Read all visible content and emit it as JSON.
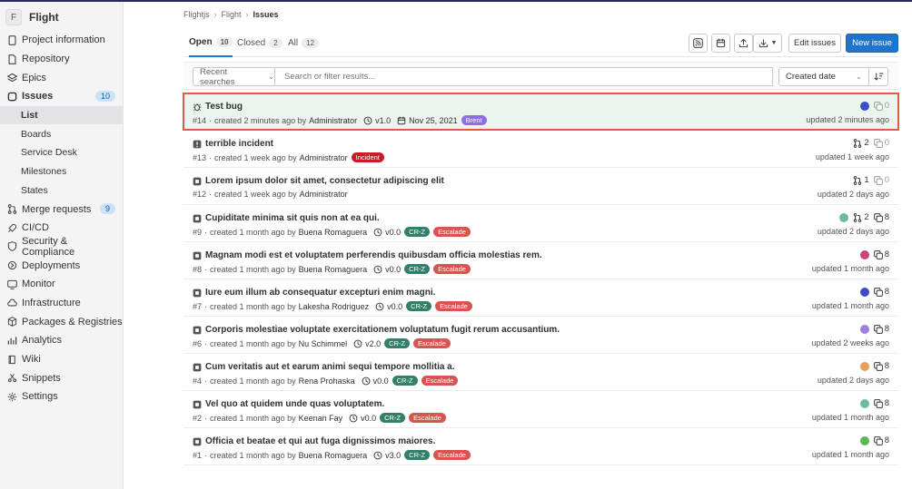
{
  "project": {
    "avatar_letter": "F",
    "name": "Flight"
  },
  "sidebar": {
    "items": [
      {
        "label": "Project information",
        "icon": "info-icon"
      },
      {
        "label": "Repository",
        "icon": "doc-icon"
      },
      {
        "label": "Epics",
        "icon": "epic-icon"
      },
      {
        "label": "Issues",
        "icon": "issues-icon",
        "count": "10"
      },
      {
        "label": "Merge requests",
        "icon": "merge-request-icon",
        "count": "9"
      },
      {
        "label": "CI/CD",
        "icon": "rocket-icon"
      },
      {
        "label": "Security & Compliance",
        "icon": "shield-icon"
      },
      {
        "label": "Deployments",
        "icon": "deployments-icon"
      },
      {
        "label": "Monitor",
        "icon": "monitor-icon"
      },
      {
        "label": "Infrastructure",
        "icon": "cloud-icon"
      },
      {
        "label": "Packages & Registries",
        "icon": "package-icon"
      },
      {
        "label": "Analytics",
        "icon": "chart-icon"
      },
      {
        "label": "Wiki",
        "icon": "book-icon"
      },
      {
        "label": "Snippets",
        "icon": "snippet-icon"
      },
      {
        "label": "Settings",
        "icon": "gear-icon"
      }
    ],
    "issues_sub": [
      "List",
      "Boards",
      "Service Desk",
      "Milestones",
      "States"
    ]
  },
  "breadcrumb": {
    "group": "Flightjs",
    "project": "Flight",
    "current": "Issues"
  },
  "tabs": [
    {
      "label": "Open",
      "count": "10"
    },
    {
      "label": "Closed",
      "count": "2"
    },
    {
      "label": "All",
      "count": "12"
    }
  ],
  "actions": {
    "edit_label": "Edit issues",
    "new_label": "New issue"
  },
  "filter": {
    "recent_label": "Recent searches",
    "search_placeholder": "Search or filter results...",
    "sort_label": "Created date"
  },
  "colors": {
    "accent": "#1f75cb",
    "crz": "#347f6a",
    "escalade": "#d9534f",
    "incident": "#c91c28",
    "brent": "#8f6fe0",
    "highlight": "#e05b3f"
  },
  "issues": [
    {
      "title": "Test bug",
      "type": "bug",
      "ref": "#14",
      "created": "created 2 minutes ago by",
      "author": "Administrator",
      "milestone": "v1.0",
      "due": "Nov 25, 2021",
      "labels": [
        {
          "text": "Brent",
          "color": "#8f6fe0"
        }
      ],
      "mr": "",
      "comments": "0",
      "updated": "updated 2 minutes ago",
      "avatar_color": "#3b4fc4"
    },
    {
      "title": "terrible incident",
      "type": "incident",
      "ref": "#13",
      "created": "created 1 week ago by",
      "author": "Administrator",
      "milestone": "",
      "due": "",
      "labels": [
        {
          "text": "Incident",
          "color": "#c91c28"
        }
      ],
      "mr": "2",
      "comments": "0",
      "updated": "updated 1 week ago",
      "avatar_color": ""
    },
    {
      "title": "Lorem ipsum dolor sit amet, consectetur adipiscing elit",
      "type": "issue",
      "ref": "#12",
      "created": "created 1 week ago by",
      "author": "Administrator",
      "milestone": "",
      "due": "",
      "labels": [],
      "mr": "1",
      "comments": "0",
      "updated": "updated 2 days ago",
      "avatar_color": ""
    },
    {
      "title": "Cupiditate minima sit quis non at ea qui.",
      "type": "issue",
      "ref": "#9",
      "created": "created 1 month ago by",
      "author": "Buena Romaguera",
      "milestone": "v0.0",
      "due": "",
      "labels": [
        {
          "text": "CR-Z",
          "color": "#347f6a"
        },
        {
          "text": "Escalade",
          "color": "#d9534f"
        }
      ],
      "mr": "2",
      "comments": "8",
      "updated": "updated 2 days ago",
      "avatar_color": "#6fb8a3"
    },
    {
      "title": "Magnam modi est et voluptatem perferendis quibusdam officia molestias rem.",
      "type": "issue",
      "ref": "#8",
      "created": "created 1 month ago by",
      "author": "Buena Romaguera",
      "milestone": "v0.0",
      "due": "",
      "labels": [
        {
          "text": "CR-Z",
          "color": "#347f6a"
        },
        {
          "text": "Escalade",
          "color": "#d9534f"
        }
      ],
      "mr": "",
      "comments": "8",
      "updated": "updated 1 month ago",
      "avatar_color": "#c4467a"
    },
    {
      "title": "Iure eum illum ab consequatur excepturi enim magni.",
      "type": "issue",
      "ref": "#7",
      "created": "created 1 month ago by",
      "author": "Lakesha Rodriguez",
      "milestone": "v0.0",
      "due": "",
      "labels": [
        {
          "text": "CR-Z",
          "color": "#347f6a"
        },
        {
          "text": "Escalade",
          "color": "#d9534f"
        }
      ],
      "mr": "",
      "comments": "8",
      "updated": "updated 1 month ago",
      "avatar_color": "#3b4fc4"
    },
    {
      "title": "Corporis molestiae voluptate exercitationem voluptatum fugit rerum accusantium.",
      "type": "issue",
      "ref": "#6",
      "created": "created 1 month ago by",
      "author": "Nu Schimmel",
      "milestone": "v2.0",
      "due": "",
      "labels": [
        {
          "text": "CR-Z",
          "color": "#347f6a"
        },
        {
          "text": "Escalade",
          "color": "#d9534f"
        }
      ],
      "mr": "",
      "comments": "8",
      "updated": "updated 2 weeks ago",
      "avatar_color": "#9a7fe0"
    },
    {
      "title": "Cum veritatis aut et earum animi sequi tempore mollitia a.",
      "type": "issue",
      "ref": "#4",
      "created": "created 1 month ago by",
      "author": "Rena Prohaska",
      "milestone": "v0.0",
      "due": "",
      "labels": [
        {
          "text": "CR-Z",
          "color": "#347f6a"
        },
        {
          "text": "Escalade",
          "color": "#d9534f"
        }
      ],
      "mr": "",
      "comments": "8",
      "updated": "updated 2 days ago",
      "avatar_color": "#e6a05a"
    },
    {
      "title": "Vel quo at quidem unde quas voluptatem.",
      "type": "issue",
      "ref": "#2",
      "created": "created 1 month ago by",
      "author": "Keenan Fay",
      "milestone": "v0.0",
      "due": "",
      "labels": [
        {
          "text": "CR-Z",
          "color": "#347f6a"
        },
        {
          "text": "Escalade",
          "color": "#d9534f"
        }
      ],
      "mr": "",
      "comments": "8",
      "updated": "updated 1 month ago",
      "avatar_color": "#6fb8a3"
    },
    {
      "title": "Officia et beatae et qui aut fuga dignissimos maiores.",
      "type": "issue",
      "ref": "#1",
      "created": "created 1 month ago by",
      "author": "Buena Romaguera",
      "milestone": "v3.0",
      "due": "",
      "labels": [
        {
          "text": "CR-Z",
          "color": "#347f6a"
        },
        {
          "text": "Escalade",
          "color": "#d9534f"
        }
      ],
      "mr": "",
      "comments": "8",
      "updated": "updated 1 month ago",
      "avatar_color": "#5ab55a"
    }
  ]
}
